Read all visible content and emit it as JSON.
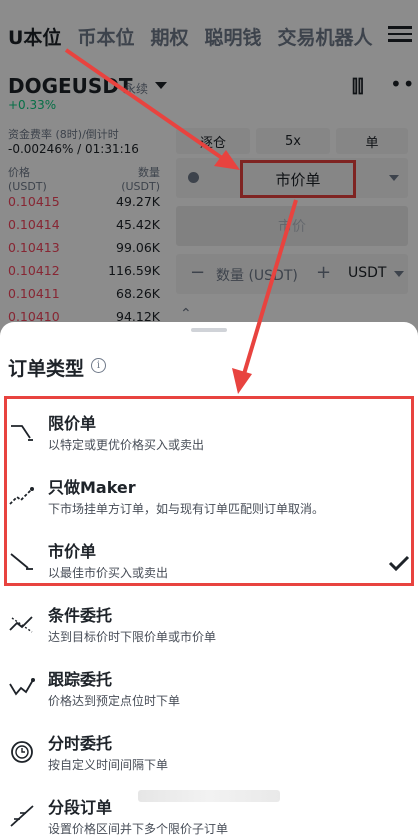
{
  "topnav": {
    "tabs": [
      "U本位",
      "币本位",
      "期权",
      "聪明钱",
      "交易机器人"
    ],
    "active_index": 0
  },
  "header": {
    "pair": "DOGEUSDT",
    "contract_type": "永续",
    "change": "+0.33%",
    "funding_label": "资金费率 (8时)/倒计时",
    "funding_value": "-0.00246% / 01:31:16"
  },
  "orderbook": {
    "price_label": "价格",
    "price_unit": "(USDT)",
    "qty_label": "数量",
    "qty_unit": "(USDT)",
    "rows": [
      {
        "price": "0.10415",
        "qty": "49.27K"
      },
      {
        "price": "0.10414",
        "qty": "45.42K"
      },
      {
        "price": "0.10413",
        "qty": "99.06K"
      },
      {
        "price": "0.10412",
        "qty": "116.59K"
      },
      {
        "price": "0.10411",
        "qty": "68.26K"
      },
      {
        "price": "0.10410",
        "qty": "94.12K"
      }
    ]
  },
  "trade_form": {
    "margin_mode": "逐仓",
    "leverage": "5x",
    "position_mode": "单",
    "order_type": "市价单",
    "price_placeholder": "市价",
    "qty_label": "数量 (USDT)",
    "qty_unit": "USDT"
  },
  "sheet": {
    "title": "订单类型",
    "selected_index": 2,
    "options": [
      {
        "title": "限价单",
        "desc": "以特定或更优价格买入或卖出",
        "icon": "limit-order-icon"
      },
      {
        "title": "只做Maker",
        "desc": "下市场挂单方订单，如与现有订单匹配则订单取消。",
        "icon": "post-only-icon"
      },
      {
        "title": "市价单",
        "desc": "以最佳市价买入或卖出",
        "icon": "market-order-icon"
      },
      {
        "title": "条件委托",
        "desc": "达到目标价时下限价单或市价单",
        "icon": "conditional-order-icon"
      },
      {
        "title": "跟踪委托",
        "desc": "价格达到预定点位时下单",
        "icon": "trailing-order-icon"
      },
      {
        "title": "分时委托",
        "desc": "按自定义时间间隔下单",
        "icon": "twap-order-icon"
      },
      {
        "title": "分段订单",
        "desc": "设置价格区间并下多个限价子订单",
        "icon": "scaled-order-icon"
      }
    ]
  },
  "colors": {
    "annotation": "#e8433f",
    "ask_red": "#f6465d",
    "up_green": "#0ecb81"
  }
}
